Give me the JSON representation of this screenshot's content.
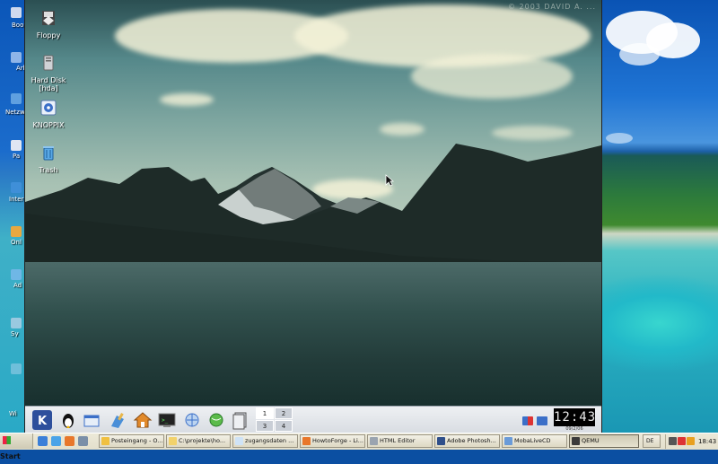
{
  "host_desktop": {
    "icon_labels": [
      "Boo",
      "Arb",
      "Netzw",
      "Pa",
      "Inter",
      "Onl",
      "Ad",
      "Sy",
      "Wi"
    ]
  },
  "guest": {
    "watermark": "© 2003 DAVID A. ...",
    "desktop_icons": [
      {
        "label": "Floppy",
        "icon": "floppy-icon"
      },
      {
        "label": "Hard Disk [hda]",
        "icon": "hard-disk-icon"
      },
      {
        "label": "KNOPPIX",
        "icon": "knoppix-icon"
      },
      {
        "label": "Trash",
        "icon": "trash-icon"
      }
    ],
    "kicker": {
      "launchers": [
        "kde-menu-icon",
        "penguin-icon",
        "window-icon",
        "paint-icon",
        "home-icon",
        "terminal-icon",
        "network-icon",
        "globe-icon",
        "files-icon"
      ],
      "pager": [
        "1",
        "2",
        "3",
        "4"
      ],
      "active_desktop": "1",
      "clock": "12:43",
      "date": "09/2/06"
    }
  },
  "taskbar": {
    "start_label": "Start",
    "buttons": [
      {
        "label": "Posteingang - O...",
        "icon": "outlook-icon"
      },
      {
        "label": "C:\\projekte\\ho...",
        "icon": "folder-icon"
      },
      {
        "label": "zugangsdaten ...",
        "icon": "notepad-icon"
      },
      {
        "label": "HowtoForge - Li...",
        "icon": "firefox-icon"
      },
      {
        "label": "HTML Editor",
        "icon": "html-editor-icon"
      },
      {
        "label": "Adobe Photosh...",
        "icon": "photoshop-icon"
      },
      {
        "label": "MobaLiveCD",
        "icon": "moba-icon"
      },
      {
        "label": "QEMU",
        "icon": "qemu-icon"
      }
    ],
    "tray_lang": "DE",
    "clock": "18:43"
  },
  "colors": {
    "host_accent": "#0a53b4",
    "kicker_bg": "#dfe2e7",
    "taskbar_bg": "#ece9d8"
  }
}
